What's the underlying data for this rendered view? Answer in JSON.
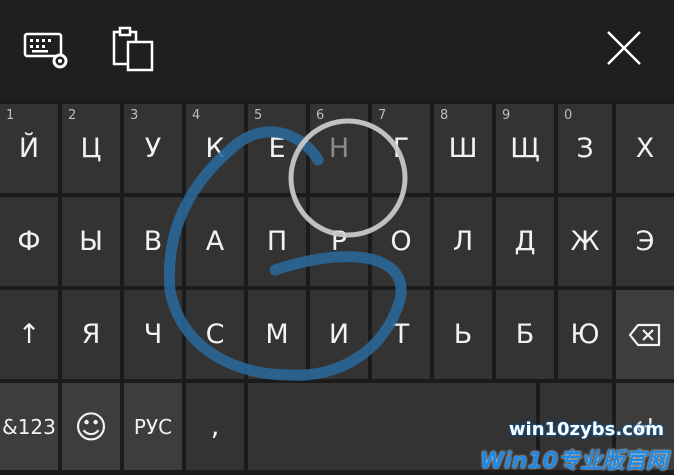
{
  "toolbar": {
    "keyboard_settings_icon": "keyboard-settings-icon",
    "clipboard_icon": "clipboard-icon",
    "close_icon": "close-icon"
  },
  "rows": {
    "row1": [
      {
        "num": "1",
        "label": "Й"
      },
      {
        "num": "2",
        "label": "Ц"
      },
      {
        "num": "3",
        "label": "У"
      },
      {
        "num": "4",
        "label": "К"
      },
      {
        "num": "5",
        "label": "Е"
      },
      {
        "num": "6",
        "label": "Н"
      },
      {
        "num": "7",
        "label": "Г"
      },
      {
        "num": "8",
        "label": "Ш"
      },
      {
        "num": "9",
        "label": "Щ"
      },
      {
        "num": "0",
        "label": "З"
      },
      {
        "num": "",
        "label": "Х"
      }
    ],
    "row2": [
      "Ф",
      "Ы",
      "В",
      "А",
      "П",
      "Р",
      "О",
      "Л",
      "Д",
      "Ж",
      "Э"
    ],
    "row3": [
      "↑",
      "Я",
      "Ч",
      "С",
      "М",
      "И",
      "Т",
      "Ь",
      "Б",
      "Ю"
    ],
    "row4": {
      "symbols": "&123",
      "emoji": "☺",
      "language": "РУС",
      "comma": ",",
      "enter": "↵"
    }
  },
  "watermark": {
    "line1": "win10zybs.com",
    "line2": "Win10专业版官网"
  },
  "colors": {
    "key": "#333333",
    "toolbar": "#1f1f1f",
    "stroke": "#2a6a9e"
  }
}
